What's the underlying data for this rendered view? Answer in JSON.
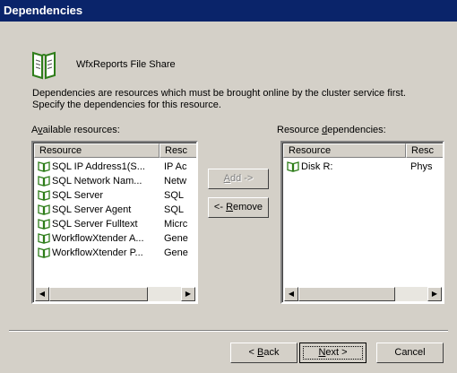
{
  "window": {
    "title": "Dependencies"
  },
  "header": {
    "resource_name": "WfxReports File Share"
  },
  "description": {
    "line1": "Dependencies are resources which must be brought online by the cluster service first.",
    "line2": "Specify the dependencies for this resource."
  },
  "available": {
    "label_pre": "A",
    "label_accel": "v",
    "label_post": "ailable resources:",
    "columns": [
      "Resource",
      "Resc"
    ],
    "rows": [
      [
        "SQL IP Address1(S...",
        "IP Ac"
      ],
      [
        "SQL Network Nam...",
        "Netw"
      ],
      [
        "SQL Server",
        "SQL"
      ],
      [
        "SQL Server Agent",
        "SQL"
      ],
      [
        "SQL Server Fulltext",
        "Micrc"
      ],
      [
        "WorkflowXtender A...",
        "Gene"
      ],
      [
        "WorkflowXtender P...",
        "Gene"
      ]
    ]
  },
  "dependencies": {
    "label_pre": "Resource ",
    "label_accel": "d",
    "label_post": "ependencies:",
    "columns": [
      "Resource",
      "Resc"
    ],
    "rows": [
      [
        "Disk R:",
        "Phys"
      ]
    ]
  },
  "buttons": {
    "add": {
      "accel": "A",
      "rest": "dd ->"
    },
    "remove": {
      "pre": "<- ",
      "accel": "R",
      "rest": "emove"
    },
    "back": {
      "pre": "< ",
      "accel": "B",
      "rest": "ack"
    },
    "next": {
      "accel": "N",
      "rest": "ext >"
    },
    "cancel": "Cancel"
  },
  "icons": {
    "resource": "book-icon",
    "header": "book-icon"
  },
  "colors": {
    "titlebar": "#0a246a",
    "dialog_bg": "#d4d0c8",
    "icon_green": "#2e7d1a"
  }
}
